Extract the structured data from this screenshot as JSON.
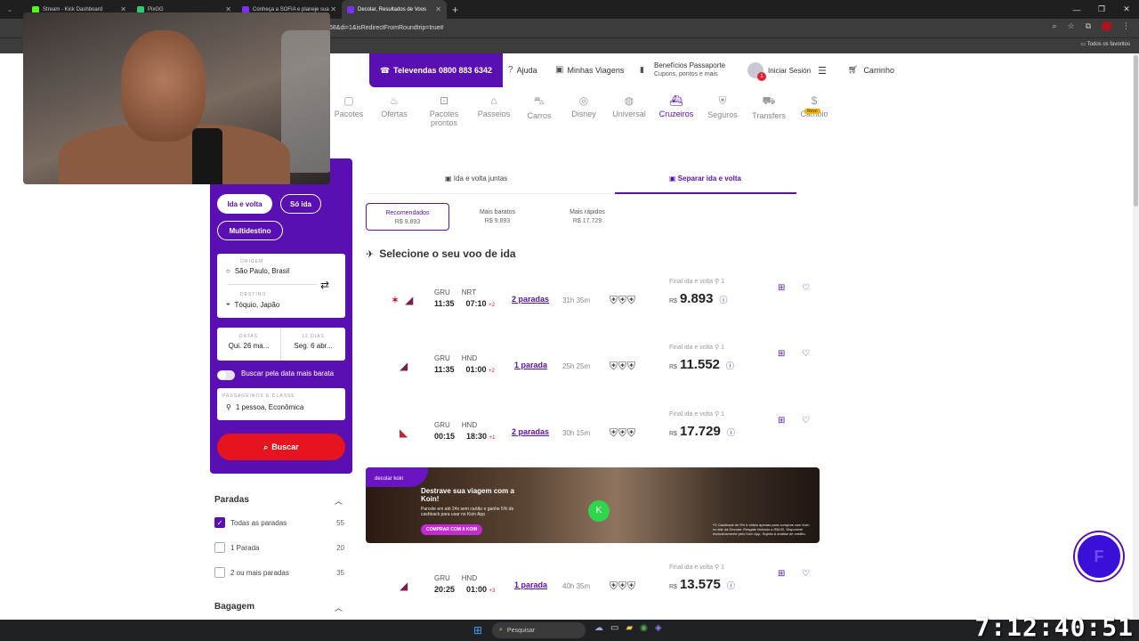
{
  "browser": {
    "tabs": [
      {
        "title": "Stream - Kick Dashboard",
        "color": "#53fc18"
      },
      {
        "title": "PixGG",
        "color": "#2ecc71"
      },
      {
        "title": "Conheça a SOFIA e planeje sua",
        "color": "#7b2ff7"
      },
      {
        "title": "Decolar, Resultados de Voos",
        "color": "#7b2ff7",
        "active": true
      }
    ],
    "url": "58&di=1&isRedirectFromRoundtrip=true#",
    "bookmarks_all": "Todos os favoritos"
  },
  "header": {
    "televendas": "Televendas 0800 883 6342",
    "ajuda": "Ajuda",
    "minhas_viagens": "Minhas Viagens",
    "beneficios_title": "Benefícios Passaporte",
    "beneficios_sub": "Cupons, pontos e mais",
    "login": "Iniciar Sesión",
    "login_badge": "1",
    "cart": "Carrinho"
  },
  "products": [
    {
      "label": "Pacotes",
      "icon": "suitcase-icon"
    },
    {
      "label": "Ofertas",
      "icon": "flame-icon"
    },
    {
      "label": "Pacotes prontos",
      "icon": "package-icon"
    },
    {
      "label": "Passeios",
      "icon": "ticket-icon"
    },
    {
      "label": "Carros",
      "icon": "car-icon"
    },
    {
      "label": "Disney",
      "icon": "mickey-icon"
    },
    {
      "label": "Universal",
      "icon": "globe-icon"
    },
    {
      "label": "Cruzeiros",
      "icon": "ship-icon",
      "active": true
    },
    {
      "label": "Seguros",
      "icon": "shield-icon"
    },
    {
      "label": "Transfers",
      "icon": "van-icon"
    },
    {
      "label": "Câmbio",
      "icon": "coin-icon",
      "badge": "Novo"
    }
  ],
  "search": {
    "trip_round": "Ida e volta",
    "trip_oneway": "Só ida",
    "trip_multi": "Multidestino",
    "origin_label": "ORIGEM",
    "origin": "São Paulo, Brasil",
    "dest_label": "DESTINO",
    "dest": "Tóquio, Japão",
    "dates_label": "DATAS",
    "date_start": "Qui. 26 ma...",
    "days_label": "12 DIAS",
    "date_end": "Seg. 6 abr...",
    "cheapest_toggle": "Buscar pela data mais barata",
    "pax_label": "PASSAGEIROS E CLASSE",
    "pax": "1 pessoa, Econômica",
    "button": "Buscar"
  },
  "filters": {
    "paradas_title": "Paradas",
    "options": [
      {
        "label": "Todas as paradas",
        "count": "55",
        "checked": true
      },
      {
        "label": "1 Parada",
        "count": "20",
        "checked": false
      },
      {
        "label": "2 ou mais paradas",
        "count": "35",
        "checked": false
      }
    ],
    "bagagem_title": "Bagagem"
  },
  "results": {
    "tab_together": "Ida e volta juntas",
    "tab_separate": "Separar ida e volta",
    "sort": [
      {
        "label": "Recomendados",
        "price": "R$ 9.893",
        "active": true
      },
      {
        "label": "Mais baratos",
        "price": "R$ 9.893"
      },
      {
        "label": "Mais rápidos",
        "price": "R$ 17.729"
      }
    ],
    "section_title": "Selecione o seu voo de ida",
    "flights": [
      {
        "from": "GRU",
        "to": "NRT",
        "dep": "11:35",
        "arr": "07:10",
        "plus": "+2",
        "stops": "2 paradas",
        "duration": "31h 35m",
        "price_label": "Final ida e volta",
        "pax": "1",
        "currency": "R$",
        "price": "9.893",
        "airlines": [
          "logo-a",
          "logo-b"
        ]
      },
      {
        "from": "GRU",
        "to": "HND",
        "dep": "11:35",
        "arr": "01:00",
        "plus": "+2",
        "stops": "1 parada",
        "duration": "25h 25m",
        "price_label": "Final ida e volta",
        "pax": "1",
        "currency": "R$",
        "price": "11.552",
        "airlines": [
          "logo-b"
        ]
      },
      {
        "from": "GRU",
        "to": "HND",
        "dep": "00:15",
        "arr": "18:30",
        "plus": "+1",
        "stops": "2 paradas",
        "duration": "30h 15m",
        "price_label": "Final ida e volta",
        "pax": "1",
        "currency": "R$",
        "price": "17.729",
        "airlines": [
          "logo-c"
        ]
      },
      {
        "from": "GRU",
        "to": "HND",
        "dep": "20:25",
        "arr": "01:00",
        "plus": "+3",
        "stops": "1 parada",
        "duration": "40h 35m",
        "price_label": "Final ida e volta",
        "pax": "1",
        "currency": "R$",
        "price": "13.575",
        "airlines": [
          "logo-b"
        ]
      }
    ]
  },
  "banner": {
    "brand": "decolar  koin",
    "headline": "Destrave sua viagem com a Koin!",
    "desc": "Parcele em até 24x sem cartão e ganhe 5% de cashback para usar no Koin App",
    "cta": "COMPRAR COM A KOIN",
    "legal": "*O Cashback de 5% é válido apenas para compras com Koin no site da Decolar. Resgate limitado a R$100. Disponível exclusivamente pelo Koin App. Sujeito à análise de crédito."
  },
  "chat_fab": "F",
  "taskbar": {
    "search": "Pesquisar"
  },
  "clock": "7:12:40:51",
  "colors": {
    "brand_purple": "#5a0fb2",
    "cta_red": "#e6141e"
  }
}
